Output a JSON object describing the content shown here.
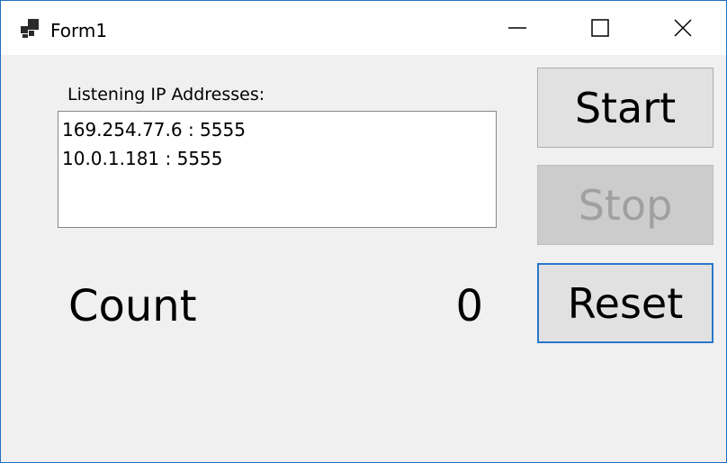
{
  "window": {
    "title": "Form1",
    "icon": "app-window-icon",
    "minimize_icon": "minimize-icon",
    "maximize_icon": "maximize-icon",
    "close_icon": "close-icon"
  },
  "listener": {
    "label": "Listening IP Addresses:",
    "addresses": [
      "169.254.77.6 : 5555",
      "10.0.1.181 : 5555"
    ]
  },
  "counter": {
    "label": "Count",
    "value": "0"
  },
  "buttons": {
    "start_label": "Start",
    "stop_label": "Stop",
    "stop_enabled": false,
    "reset_label": "Reset",
    "reset_focused": true
  },
  "colors": {
    "window_border": "#1f6fc0",
    "focus_border": "#2a77cc",
    "disabled_text": "#a0a0a0"
  }
}
